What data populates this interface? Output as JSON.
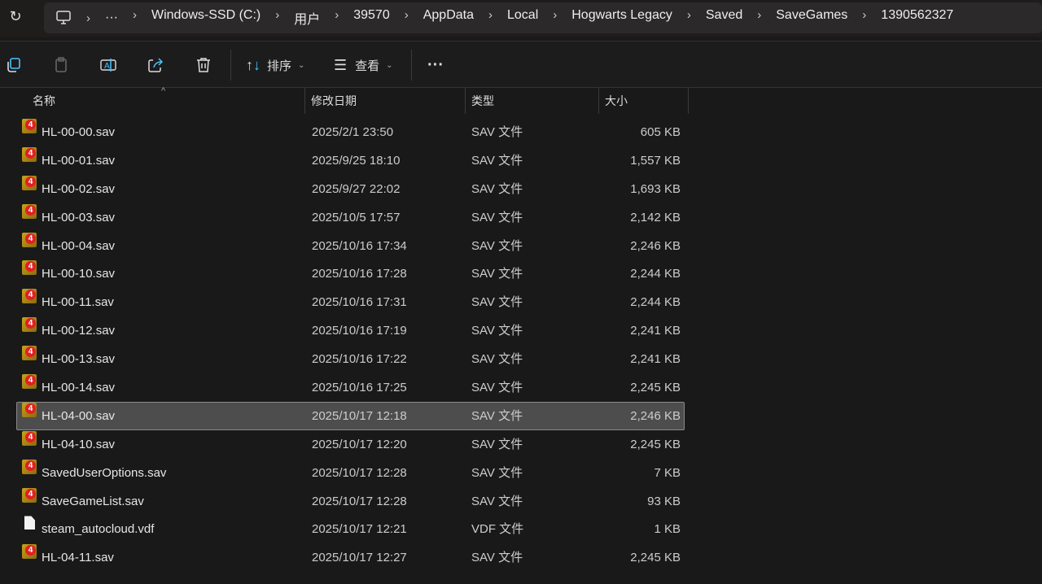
{
  "address": {
    "crumbs": [
      "Windows-SSD (C:)",
      "用户",
      "39570",
      "AppData",
      "Local",
      "Hogwarts Legacy",
      "Saved",
      "SaveGames",
      "1390562327"
    ]
  },
  "toolbar": {
    "sort_label": "排序",
    "view_label": "查看"
  },
  "columns": {
    "name": "名称",
    "date": "修改日期",
    "type": "类型",
    "size": "大小"
  },
  "files": [
    {
      "name": "HL-00-00.sav",
      "date": "2025/2/1 23:50",
      "type": "SAV 文件",
      "size": "605 KB",
      "icon": "game"
    },
    {
      "name": "HL-00-01.sav",
      "date": "2025/9/25 18:10",
      "type": "SAV 文件",
      "size": "1,557 KB",
      "icon": "game"
    },
    {
      "name": "HL-00-02.sav",
      "date": "2025/9/27 22:02",
      "type": "SAV 文件",
      "size": "1,693 KB",
      "icon": "game"
    },
    {
      "name": "HL-00-03.sav",
      "date": "2025/10/5 17:57",
      "type": "SAV 文件",
      "size": "2,142 KB",
      "icon": "game"
    },
    {
      "name": "HL-00-04.sav",
      "date": "2025/10/16 17:34",
      "type": "SAV 文件",
      "size": "2,246 KB",
      "icon": "game"
    },
    {
      "name": "HL-00-10.sav",
      "date": "2025/10/16 17:28",
      "type": "SAV 文件",
      "size": "2,244 KB",
      "icon": "game"
    },
    {
      "name": "HL-00-11.sav",
      "date": "2025/10/16 17:31",
      "type": "SAV 文件",
      "size": "2,244 KB",
      "icon": "game"
    },
    {
      "name": "HL-00-12.sav",
      "date": "2025/10/16 17:19",
      "type": "SAV 文件",
      "size": "2,241 KB",
      "icon": "game"
    },
    {
      "name": "HL-00-13.sav",
      "date": "2025/10/16 17:22",
      "type": "SAV 文件",
      "size": "2,241 KB",
      "icon": "game"
    },
    {
      "name": "HL-00-14.sav",
      "date": "2025/10/16 17:25",
      "type": "SAV 文件",
      "size": "2,245 KB",
      "icon": "game"
    },
    {
      "name": "HL-04-00.sav",
      "date": "2025/10/17 12:18",
      "type": "SAV 文件",
      "size": "2,246 KB",
      "icon": "game",
      "selected": true
    },
    {
      "name": "HL-04-10.sav",
      "date": "2025/10/17 12:20",
      "type": "SAV 文件",
      "size": "2,245 KB",
      "icon": "game"
    },
    {
      "name": "SavedUserOptions.sav",
      "date": "2025/10/17 12:28",
      "type": "SAV 文件",
      "size": "7 KB",
      "icon": "game"
    },
    {
      "name": "SaveGameList.sav",
      "date": "2025/10/17 12:28",
      "type": "SAV 文件",
      "size": "93 KB",
      "icon": "game"
    },
    {
      "name": "steam_autocloud.vdf",
      "date": "2025/10/17 12:21",
      "type": "VDF 文件",
      "size": "1 KB",
      "icon": "document"
    },
    {
      "name": "HL-04-11.sav",
      "date": "2025/10/17 12:27",
      "type": "SAV 文件",
      "size": "2,245 KB",
      "icon": "game"
    }
  ]
}
